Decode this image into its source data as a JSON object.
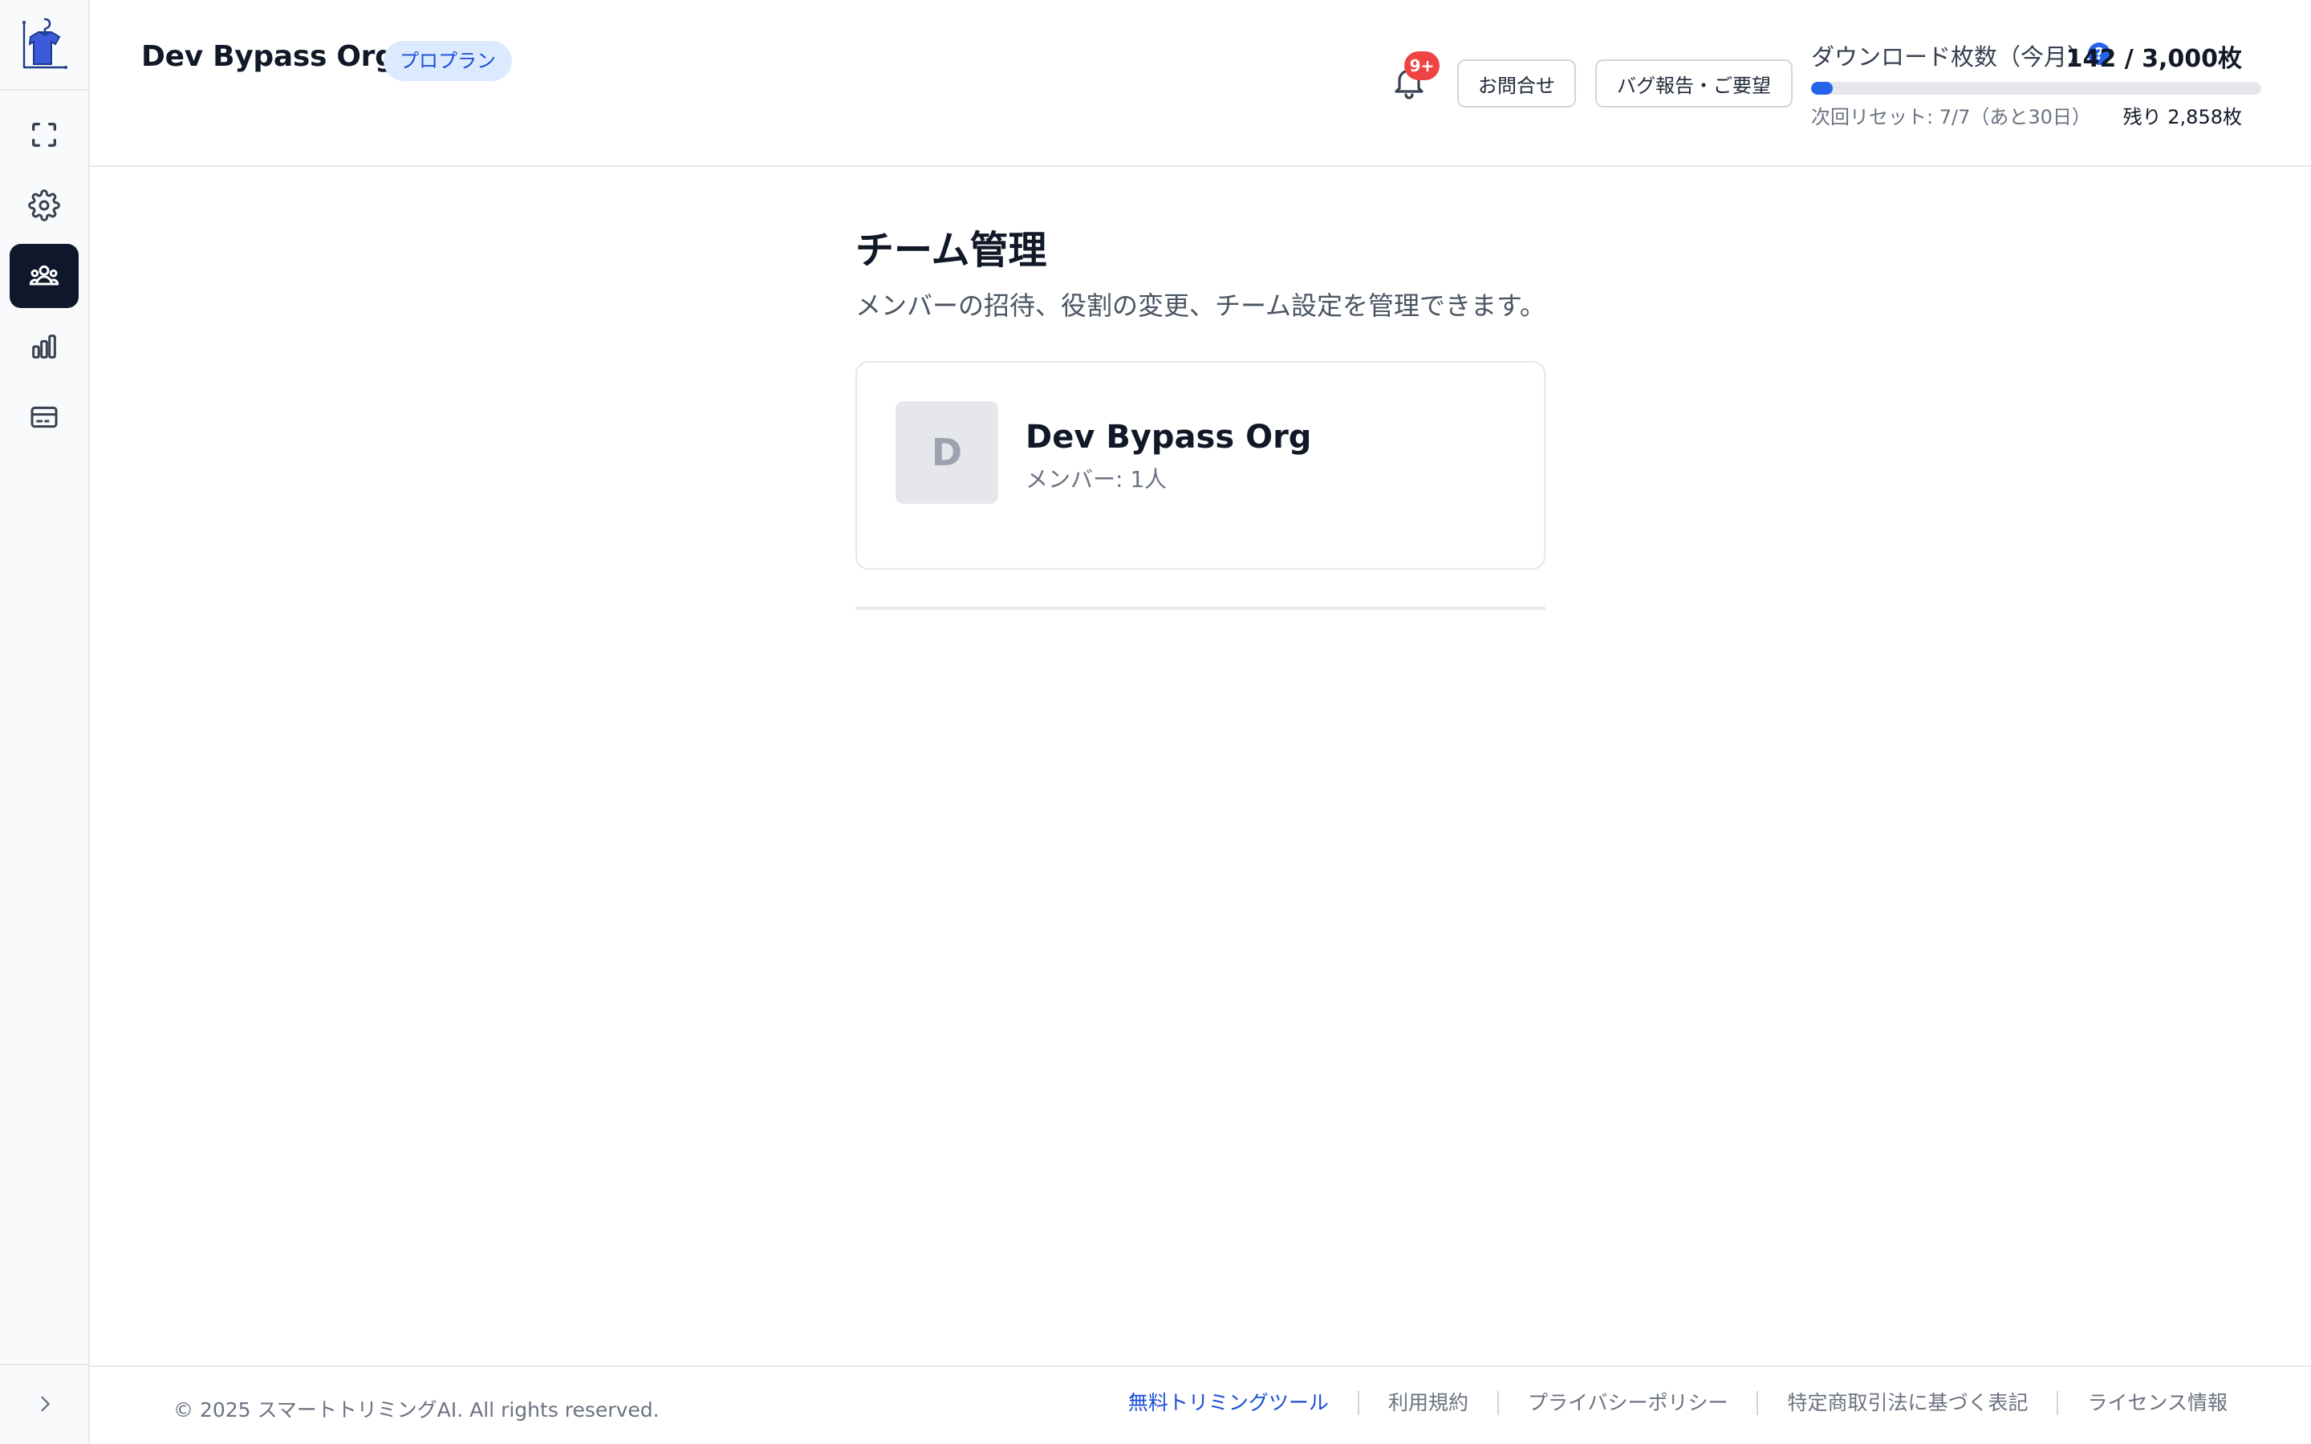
{
  "sidebar": {
    "logo_icon": "hanger-shirt-logo",
    "items": [
      {
        "icon": "fullscreen-icon",
        "active": false
      },
      {
        "icon": "gear-icon",
        "active": false
      },
      {
        "icon": "team-icon",
        "active": true
      },
      {
        "icon": "bar-chart-icon",
        "active": false
      },
      {
        "icon": "credit-card-icon",
        "active": false
      }
    ],
    "expand_icon": "chevron-right-icon"
  },
  "header": {
    "org_name": "Dev Bypass Org",
    "plan_badge": "プロプラン",
    "notifications_badge": "9+",
    "contact_label": "お問合せ",
    "bug_report_label": "バグ報告・ご要望",
    "usage": {
      "label": "ダウンロード枚数（今月）",
      "help": "?",
      "count": "142 / 3,000枚",
      "used": 142,
      "limit": 3000,
      "reset_text": "次回リセット: 7/7（あと30日）",
      "remaining_text": "残り 2,858枚"
    }
  },
  "main": {
    "title": "チーム管理",
    "description": "メンバーの招待、役割の変更、チーム設定を管理できます。",
    "org_card": {
      "avatar_initial": "D",
      "name": "Dev Bypass Org",
      "members": "メンバー: 1人"
    }
  },
  "footer": {
    "copyright": "© 2025 スマートトリミングAI. All rights reserved.",
    "links": [
      "無料トリミングツール",
      "利用規約",
      "プライバシーポリシー",
      "特定商取引法に基づく表記",
      "ライセンス情報"
    ]
  },
  "colors": {
    "accent": "#2563eb",
    "badge_bg": "#dbeafe",
    "active_nav": "#0f172a",
    "notification": "#ef4444"
  }
}
